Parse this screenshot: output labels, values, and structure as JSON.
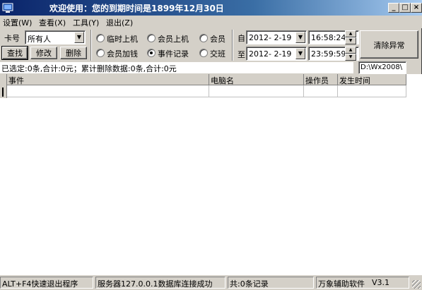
{
  "window": {
    "title": "欢迎使用：您的到期时间是1899年12月30日",
    "controls": {
      "minimize": "_",
      "maximize": "□",
      "close": "×"
    }
  },
  "menu": [
    "设置(W)",
    "查看(X)",
    "工具(Y)",
    "退出(Z)"
  ],
  "filter": {
    "card_label": "卡号",
    "card_value": "所有人",
    "query_btn": "查找",
    "modify_btn": "修改",
    "delete_btn": "删除",
    "radios": [
      {
        "label": "临时上机",
        "checked": false
      },
      {
        "label": "会员上机",
        "checked": false
      },
      {
        "label": "会员",
        "checked": false
      },
      {
        "label": "会员加钱",
        "checked": false
      },
      {
        "label": "事件记录",
        "checked": true
      },
      {
        "label": "交班",
        "checked": false
      }
    ],
    "from_label": "自",
    "to_label": "至",
    "from_date": "2012- 2-19",
    "to_date": "2012- 2-19",
    "from_time": "16:58:24",
    "to_time": "23:59:59",
    "clear_btn": "清除异常"
  },
  "summary": "已选定:0条,合计:0元；累计删除数据:0条,合计:0元",
  "path": "D:\\Wx2008\\",
  "table": {
    "columns": [
      "事件",
      "电脑名",
      "操作员",
      "发生时间"
    ],
    "rows": []
  },
  "status": {
    "hint": "ALT+F4快速退出程序",
    "server": "服务器127.0.0.1数据库连接成功",
    "count": "共:0条记录",
    "product": "万象辅助软件",
    "version": "V3.1"
  },
  "colors": {
    "titlebar_start": "#0a246a",
    "titlebar_end": "#a6caf0",
    "face": "#d4d0c8"
  }
}
